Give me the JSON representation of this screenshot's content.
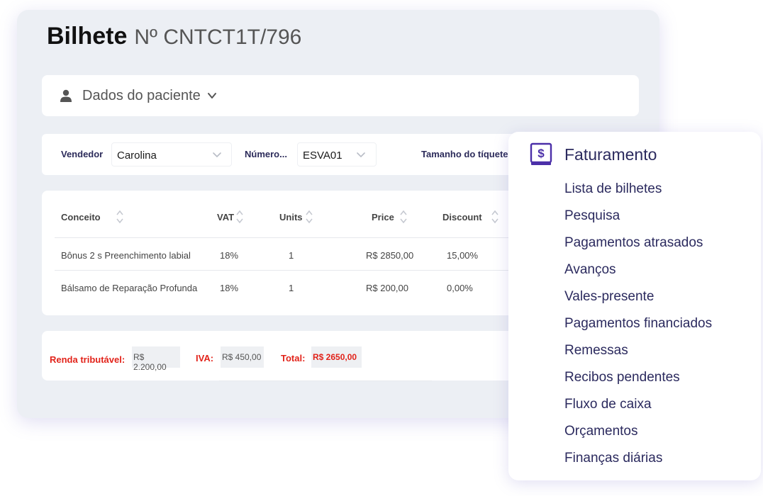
{
  "ticket": {
    "title": "Bilhete",
    "number": "Nº CNTCT1T/796"
  },
  "patient": {
    "label": "Dados do paciente",
    "icon": "person-icon"
  },
  "filters": {
    "seller_label": "Vendedor",
    "seller_value": "Carolina",
    "number_label": "Número...",
    "number_value": "ESVA01",
    "ticket_size_label": "Tamanho do tíquete"
  },
  "table": {
    "headers": [
      "Conceito",
      "VAT",
      "Units",
      "Price",
      "Discount"
    ],
    "rows": [
      [
        "Bônus 2 s Preenchimento labial",
        "18%",
        "1",
        "R$ 2850,00",
        "15,00%"
      ],
      [
        "Bálsamo de Reparação Profunda",
        "18%",
        "1",
        "R$ 200,00",
        "0,00%"
      ]
    ]
  },
  "totals": {
    "taxable_label": "Renda tributável:",
    "taxable_value": "R$ 2.200,00",
    "iva_label": "IVA:",
    "iva_value": "R$ 450,00",
    "total_label": "Total:",
    "total_value": "R$ 2650,00"
  },
  "billing_menu": {
    "title": "Faturamento",
    "icon": "billing-dollar-icon",
    "items": [
      "Lista de bilhetes",
      "Pesquisa",
      "Pagamentos atrasados",
      "Avanços",
      "Vales-presente",
      "Pagamentos financiados",
      "Remessas",
      "Recibos pendentes",
      "Fluxo de caixa",
      "Orçamentos",
      "Finanças diárias"
    ]
  },
  "colors": {
    "accent": "#2b2a5e",
    "menu_icon": "#4b2fa8",
    "total_red": "#e2231a",
    "card_bg": "#eceff4"
  }
}
